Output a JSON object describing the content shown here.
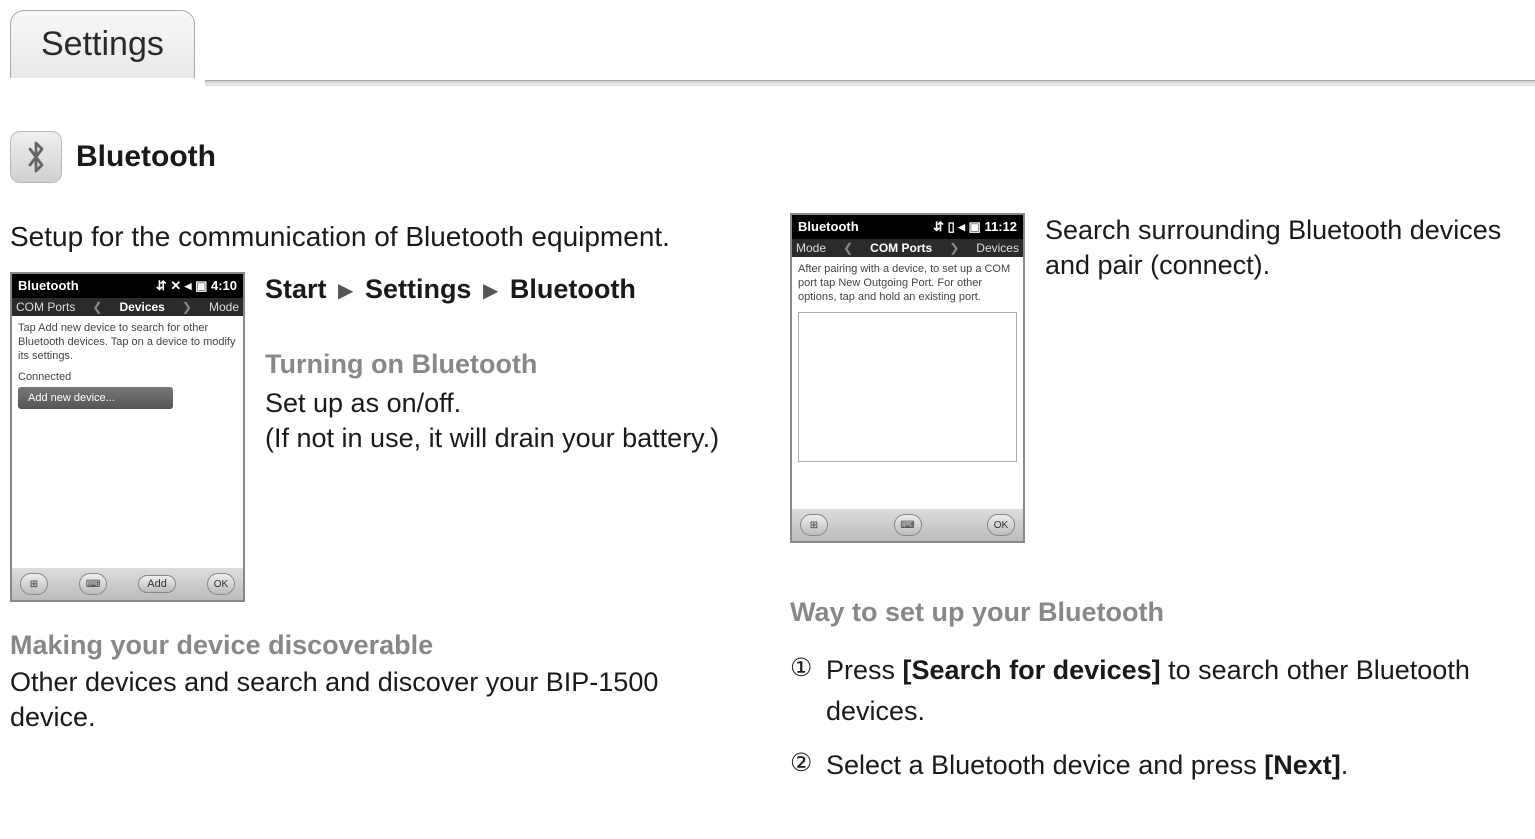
{
  "tab": {
    "label": "Settings"
  },
  "section": {
    "icon": "✱",
    "title": "Bluetooth"
  },
  "left": {
    "intro": "Setup for the communication of Bluetooth equipment.",
    "crumb": {
      "a": "Start",
      "b": "Settings",
      "c": "Bluetooth"
    },
    "sub1_title": "Turning on Bluetooth",
    "sub1_line1": "Set up as on/off.",
    "sub1_line2": "(If not in use, it will drain your battery.)",
    "sub2_title": "Making your device discoverable",
    "sub2_body": "Other devices and search and discover your BIP-1500 device.",
    "phone": {
      "title": "Bluetooth",
      "time": "4:10",
      "tabs": {
        "left": "COM Ports",
        "mid": "Devices",
        "right": "Mode"
      },
      "hint": "Tap Add new device to search for other Bluetooth devices. Tap on a device to modify its settings.",
      "connected": "Connected",
      "addnew": "Add new device...",
      "bottom": {
        "add": "Add",
        "ok": "OK"
      }
    }
  },
  "right": {
    "intro": "Search surrounding Bluetooth devices and pair (connect).",
    "sub_title": "Way to set up your Bluetooth",
    "step1_pre": "Press ",
    "step1_bold": "[Search for devices]",
    "step1_post": " to search other Bluetooth devices.",
    "step2_pre": "Select a Bluetooth device and press ",
    "step2_bold": "[Next]",
    "step2_post": ".",
    "phone": {
      "title": "Bluetooth",
      "time": "11:12",
      "tabs": {
        "left": "Mode",
        "mid": "COM Ports",
        "right": "Devices"
      },
      "hint": "After pairing with a device, to set up a COM port tap New Outgoing Port. For other options, tap and hold an existing port.",
      "bottom": {
        "ok": "OK"
      }
    }
  }
}
